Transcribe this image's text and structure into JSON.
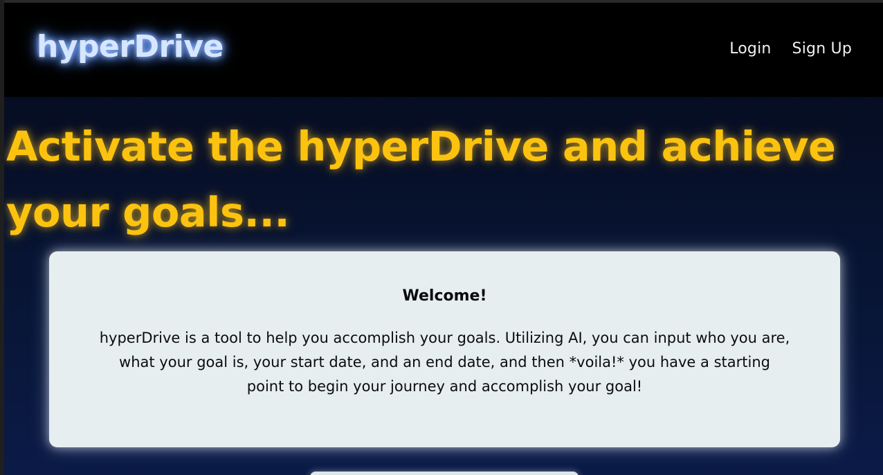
{
  "navbar": {
    "brand": "hyperDrive",
    "links": [
      {
        "label": "Login"
      },
      {
        "label": "Sign Up"
      }
    ]
  },
  "hero": {
    "title": "Activate the hyperDrive and achieve your goals..."
  },
  "welcome_card": {
    "heading": "Welcome!",
    "body": "hyperDrive is a tool to help you accomplish your goals. Utilizing AI, you can input who you are, what your goal is, your start date, and an end date, and then *voila!* you have a starting point to begin your journey and accomplish your goal!"
  },
  "colors": {
    "navbar_bg": "#000000",
    "brand_glow": "#9cc1ff",
    "hero_title": "#fbc30f",
    "card_bg": "#e6eef0",
    "page_bg_top": "#06091a",
    "page_bg_bottom": "#0b1b47"
  }
}
